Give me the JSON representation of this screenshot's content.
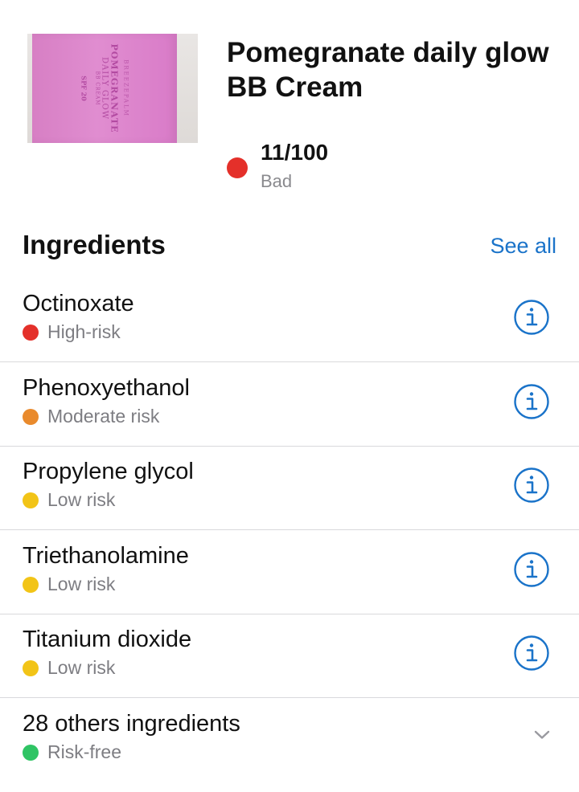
{
  "product": {
    "title_line1": "Pomegranate daily glow",
    "title_line2": "BB Cream",
    "image_text": {
      "brand": "BREEZEPALM",
      "name_line1": "POMEGRANATE",
      "name_line2": "DAILY GLOW",
      "name_line3": "BB CREAM",
      "spf": "SPF 20"
    },
    "score": "11/100",
    "score_label": "Bad",
    "score_color": "#e4302a"
  },
  "ingredients_section": {
    "title": "Ingredients",
    "see_all_label": "See all",
    "link_color": "#1a73c9"
  },
  "ingredients": [
    {
      "name": "Octinoxate",
      "risk": "High-risk",
      "color": "#e4302a",
      "icon": "info-icon"
    },
    {
      "name": "Phenoxyethanol",
      "risk": "Moderate risk",
      "color": "#e98a2c",
      "icon": "info-icon"
    },
    {
      "name": "Propylene glycol",
      "risk": "Low risk",
      "color": "#f2c417",
      "icon": "info-icon"
    },
    {
      "name": "Triethanolamine",
      "risk": "Low risk",
      "color": "#f2c417",
      "icon": "info-icon"
    },
    {
      "name": "Titanium dioxide",
      "risk": "Low risk",
      "color": "#f2c417",
      "icon": "info-icon"
    },
    {
      "name": "28 others ingredients",
      "risk": "Risk-free",
      "color": "#2fc464",
      "icon": "chevron-down-icon"
    }
  ]
}
